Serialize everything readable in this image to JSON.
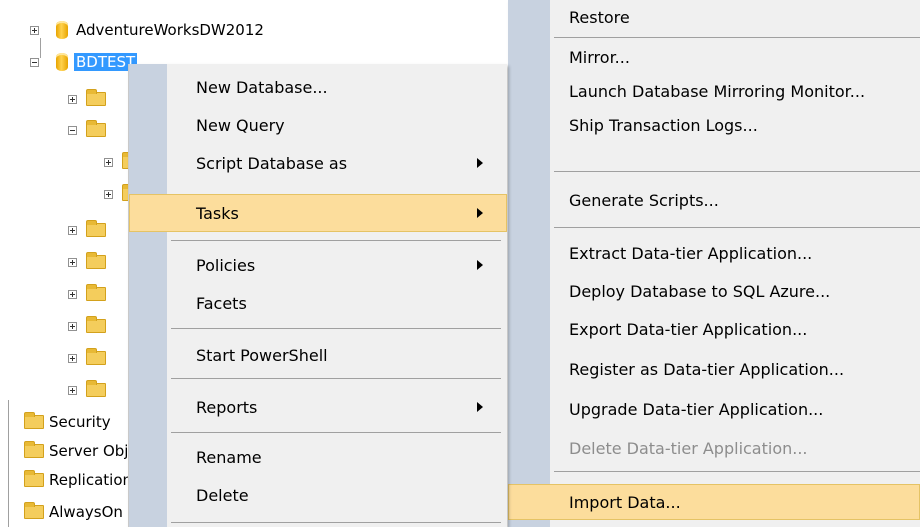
{
  "tree": {
    "databases": [
      {
        "label": "AdventureWorksDW2012",
        "expanded": false
      },
      {
        "label": "BDTEST",
        "expanded": true,
        "selected": true
      }
    ],
    "bottom_folders": [
      {
        "label": "Security"
      },
      {
        "label": "Server Objects"
      },
      {
        "label": "Replication"
      },
      {
        "label": "AlwaysOn High Availability"
      }
    ]
  },
  "context_menu": {
    "items": [
      {
        "label": "New Database..."
      },
      {
        "label": "New Query"
      },
      {
        "label": "Script Database as",
        "submenu": true
      },
      {
        "label": "Tasks",
        "submenu": true,
        "highlighted": true
      },
      {
        "label": "Policies",
        "submenu": true
      },
      {
        "label": "Facets"
      },
      {
        "label": "Start PowerShell"
      },
      {
        "label": "Reports",
        "submenu": true
      },
      {
        "label": "Rename"
      },
      {
        "label": "Delete"
      }
    ]
  },
  "tasks_submenu": {
    "items": [
      {
        "label": "Restore"
      },
      {
        "label": "Mirror..."
      },
      {
        "label": "Launch Database Mirroring Monitor..."
      },
      {
        "label": "Ship Transaction Logs..."
      },
      {
        "label": "Generate Scripts..."
      },
      {
        "label": "Extract Data-tier Application..."
      },
      {
        "label": "Deploy Database to SQL Azure..."
      },
      {
        "label": "Export Data-tier Application..."
      },
      {
        "label": "Register as Data-tier Application..."
      },
      {
        "label": "Upgrade Data-tier Application..."
      },
      {
        "label": "Delete Data-tier Application...",
        "disabled": true
      },
      {
        "label": "Import Data...",
        "highlighted": true
      }
    ]
  },
  "colors": {
    "menu_bg": "#f0f0f0",
    "menu_gutter": "#c8d2e0",
    "highlight": "#fcdd9c",
    "selection": "#3399ff",
    "disabled_text": "#8d8d8d"
  }
}
